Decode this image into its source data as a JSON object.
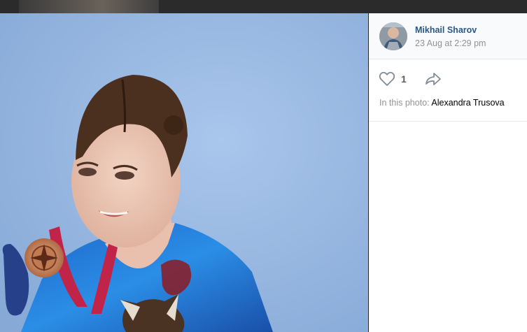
{
  "author": {
    "name": "Mikhail Sharov",
    "date": "23 Aug at 2:29 pm"
  },
  "actions": {
    "like_count": "1",
    "like_icon": "heart-outline-icon",
    "share_icon": "share-arrow-icon"
  },
  "tags": {
    "label": "In this photo:",
    "person": "Alexandra Trusova"
  },
  "colors": {
    "link": "#2a5885",
    "muted": "#939393",
    "photo_background": "#93b5e0",
    "viewer_background": "#2b2b2b"
  }
}
